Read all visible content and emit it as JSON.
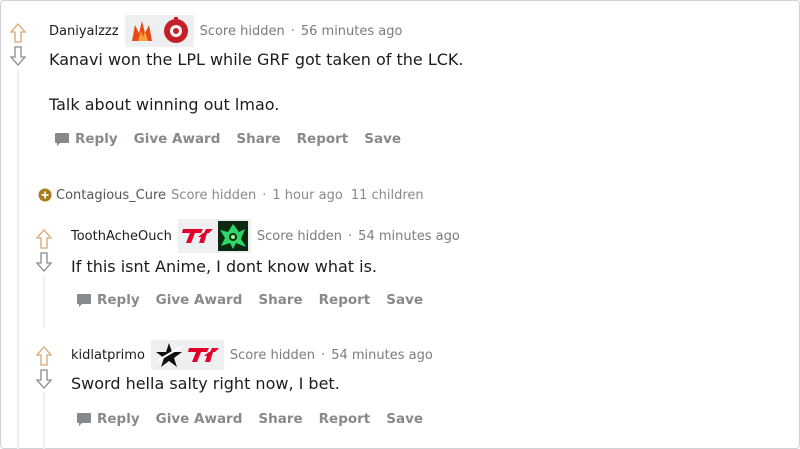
{
  "comments": [
    {
      "username": "Daniyalzzz",
      "score": "Score hidden",
      "time": "56 minutes ago",
      "lines": [
        "Kanavi won the LPL while GRF got taken of the LCK.",
        "Talk about winning out lmao."
      ]
    },
    {
      "username": "ToothAcheOuch",
      "score": "Score hidden",
      "time": "54 minutes ago",
      "lines": [
        "If this isnt Anime, I dont know what is."
      ]
    },
    {
      "username": "kidlatprimo",
      "score": "Score hidden",
      "time": "54 minutes ago",
      "lines": [
        "Sword hella salty right now, I bet."
      ]
    }
  ],
  "collapsed": {
    "username": "Contagious_Cure",
    "score": "Score hidden",
    "time": "1 hour ago",
    "children": "11 children"
  },
  "actions": {
    "reply": "Reply",
    "give_award": "Give Award",
    "share": "Share",
    "report": "Report",
    "save": "Save"
  },
  "separator": "·",
  "colors": {
    "upvote_outline": "#d9a672",
    "downvote_outline": "#878a8c",
    "action_text": "#878a8c",
    "meta_text": "#7c7c7c",
    "expand_icon": "#a67c1f"
  }
}
